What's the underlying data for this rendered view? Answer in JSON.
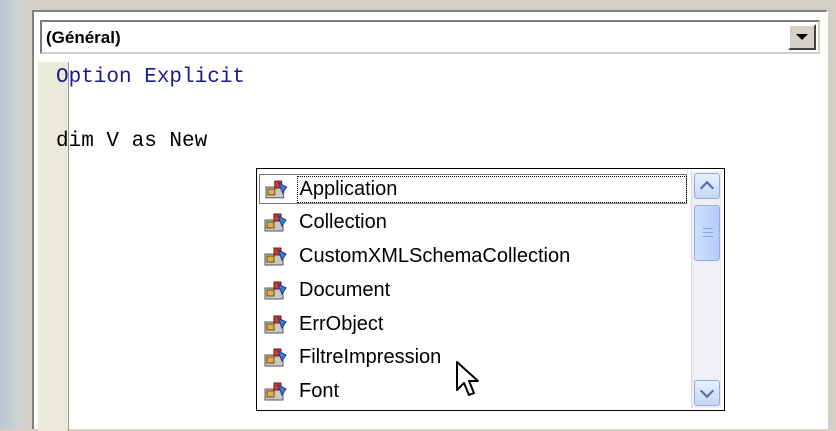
{
  "procedure_combo": {
    "value": "(Général)"
  },
  "code": {
    "line1": "Option Explicit",
    "line2": "dim V as New"
  },
  "intellisense": {
    "items": [
      {
        "label": "Application",
        "icon": "class-module-icon"
      },
      {
        "label": "Collection",
        "icon": "class-module-icon"
      },
      {
        "label": "CustomXMLSchemaCollection",
        "icon": "class-module-icon"
      },
      {
        "label": "Document",
        "icon": "class-module-icon"
      },
      {
        "label": "ErrObject",
        "icon": "class-module-icon"
      },
      {
        "label": "FiltreImpression",
        "icon": "class-module-icon"
      },
      {
        "label": "Font",
        "icon": "class-module-icon"
      }
    ],
    "selected_index": 0
  },
  "colors": {
    "keyword": "#1b1b8f",
    "margin": "#ebe9d8",
    "chrome": "#d4d0c8"
  }
}
